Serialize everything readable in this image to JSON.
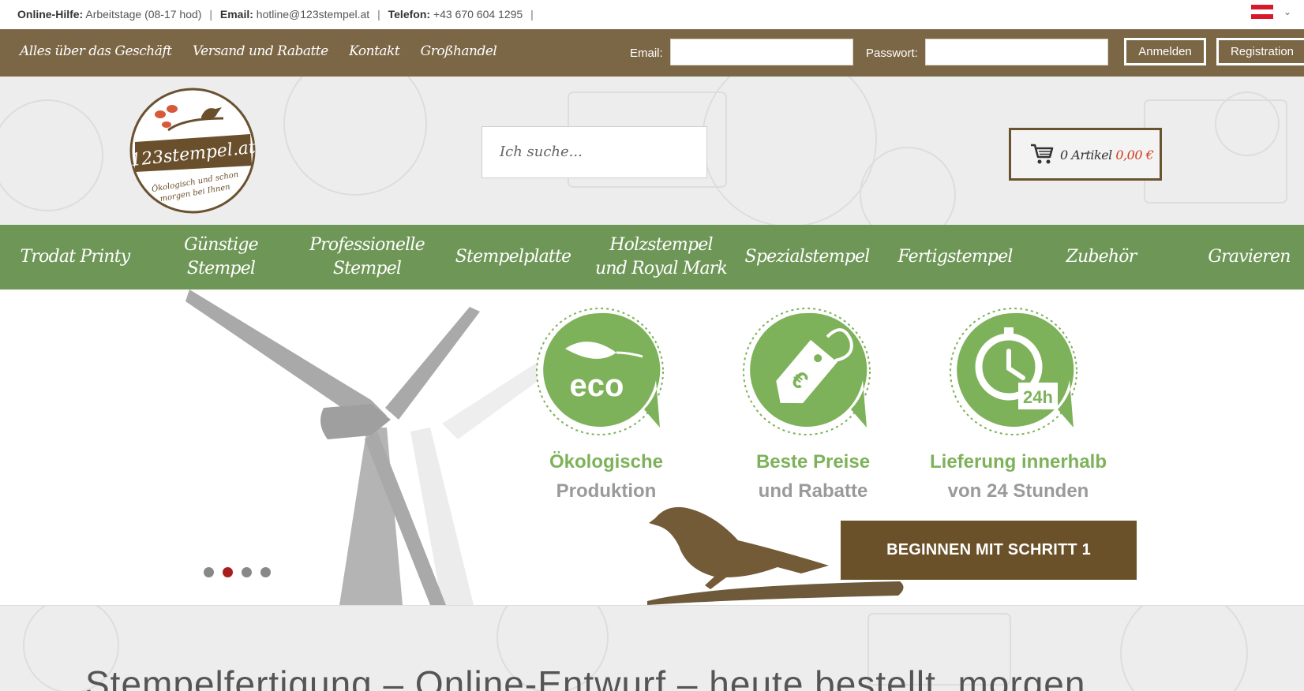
{
  "infobar": {
    "help_label": "Online-Hilfe:",
    "help_value": "Arbeitstage (08-17 hod)",
    "email_label": "Email:",
    "email_value": "hotline@123stempel.at",
    "phone_label": "Telefon:",
    "phone_value": "+43 670 604 1295",
    "separator": "|",
    "flag_colors": [
      "#d7192b",
      "#ffffff",
      "#d7192b"
    ]
  },
  "topnav": {
    "links": [
      "Alles über das Geschäft",
      "Versand und Rabatte",
      "Kontakt",
      "Großhandel"
    ],
    "email_label": "Email:",
    "password_label": "Passwort:",
    "login_button": "Anmelden",
    "register_button": "Registration"
  },
  "header": {
    "logo_text": "123stempel.at",
    "logo_tagline_1": "Ökologisch und schon",
    "logo_tagline_2": "morgen bei Ihnen",
    "search_placeholder": "Ich suche...",
    "cart_count": "0 Artikel",
    "cart_price": "0,00 €"
  },
  "categories": [
    "Trodat Printy",
    "Günstige Stempel",
    "Professionelle Stempel",
    "Stempelplatte",
    "Holzstempel und Royal Mark",
    "Spezialstempel",
    "Fertigstempel",
    "Zubehör",
    "Gravieren"
  ],
  "hero": {
    "badges": [
      {
        "icon": "eco-leaf-icon",
        "badge_text": "eco",
        "line1": "Ökologische",
        "line2": "Produktion"
      },
      {
        "icon": "price-tag-icon",
        "badge_text": "",
        "line1": "Beste Preise",
        "line2": "und Rabatte"
      },
      {
        "icon": "clock-24h-icon",
        "badge_text": "24h",
        "line1": "Lieferung innerhalb",
        "line2": "von 24 Stunden"
      }
    ],
    "cta_label": "BEGINNEN MIT SCHRITT 1",
    "slides_count": 4,
    "active_slide": 2
  },
  "headline": "Stempelfertigung – Online-Entwurf – heute bestellt, morgen",
  "colors": {
    "brown_bar": "#7b6645",
    "green_nav": "#6e9656",
    "badge_green": "#7db25a",
    "cta_brown": "#6a5129",
    "price_red": "#d23b1a"
  }
}
